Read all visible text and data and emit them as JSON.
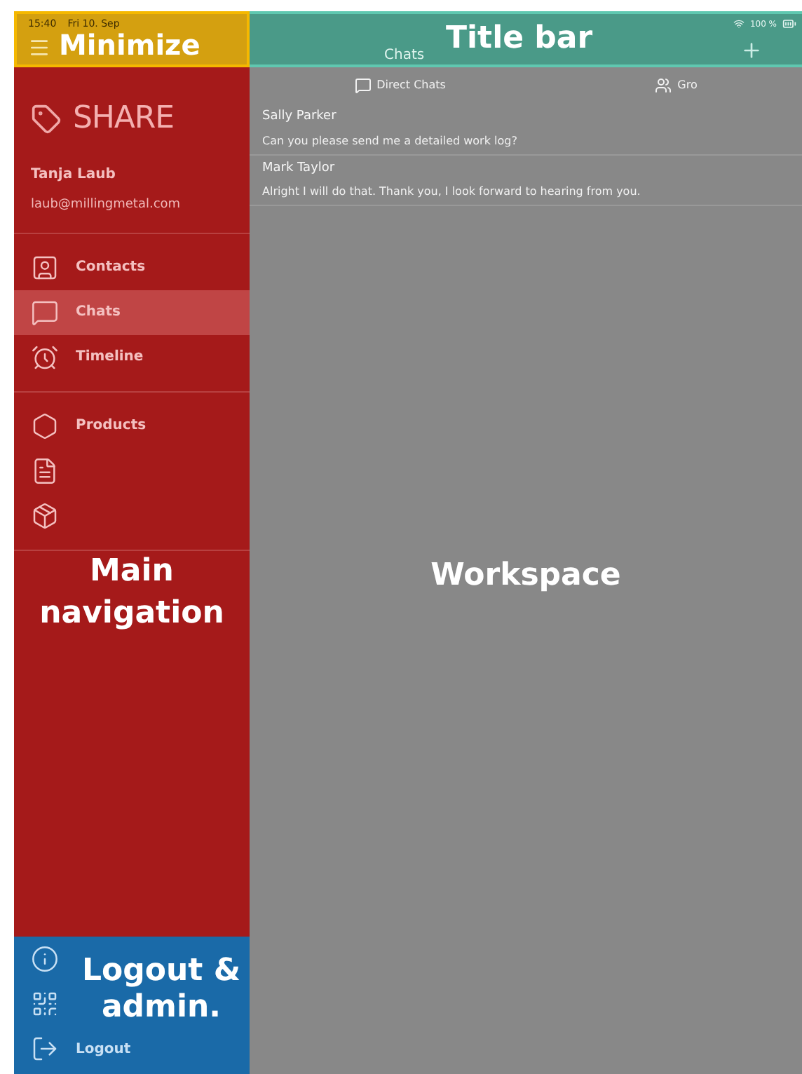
{
  "status_bar": {
    "time": "15:40",
    "date": "Fri 10. Sep",
    "battery": "100 %"
  },
  "sidebar": {
    "logo": "SHARE",
    "user_name": "Tanja Laub",
    "user_email": "laub@millingmetal.com",
    "groups": [
      [
        {
          "kind": "contacts",
          "label": "Contacts",
          "selected": false
        },
        {
          "kind": "chats",
          "label": "Chats",
          "selected": true
        },
        {
          "kind": "timeline",
          "label": "Timeline",
          "selected": false
        }
      ],
      [
        {
          "kind": "products",
          "label": "Products",
          "selected": false
        },
        {
          "kind": "catalog",
          "selected": false
        },
        {
          "kind": "work",
          "selected": false
        }
      ]
    ],
    "footer": [
      {
        "kind": "about"
      },
      {
        "kind": "qr"
      },
      {
        "kind": "logout",
        "label": "Logout"
      }
    ]
  },
  "title_bar": {
    "title": "Chats"
  },
  "segments": [
    {
      "kind": "direct",
      "label": "Direct Chats"
    },
    {
      "kind": "group",
      "label": "Gro"
    }
  ],
  "chats": [
    {
      "name": "Sally Parker",
      "message": "Can you please send me a detailed work log?"
    },
    {
      "name": "Mark Taylor",
      "message": "Alright I will do that. Thank you, I look forward to hearing from you."
    }
  ],
  "annotations": [
    {
      "kind": "minimize",
      "label": "Minimize",
      "color": "#d4a010"
    },
    {
      "kind": "title",
      "label": "Title bar",
      "color": "#4a9a88"
    },
    {
      "kind": "nav",
      "label": "Main navigation",
      "color": "#a51a1a"
    },
    {
      "kind": "workspace",
      "label": "Workspace",
      "color": "#888888"
    },
    {
      "kind": "admin",
      "label": "Logout & admin.",
      "color": "#1a6aa8"
    }
  ]
}
